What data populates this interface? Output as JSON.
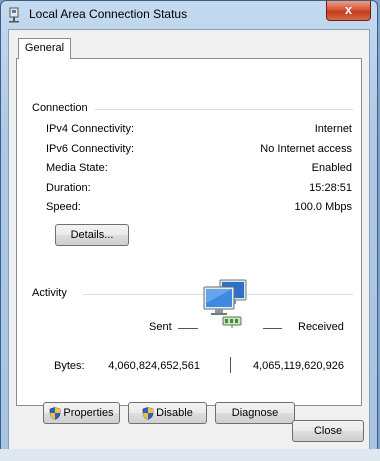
{
  "window": {
    "title": "Local Area Connection Status",
    "close_glyph": "x"
  },
  "tabs": [
    {
      "label": "General"
    }
  ],
  "connection": {
    "group_label": "Connection",
    "rows": [
      {
        "label": "IPv4 Connectivity:",
        "value": "Internet"
      },
      {
        "label": "IPv6 Connectivity:",
        "value": "No Internet access"
      },
      {
        "label": "Media State:",
        "value": "Enabled"
      },
      {
        "label": "Duration:",
        "value": "15:28:51"
      },
      {
        "label": "Speed:",
        "value": "100.0 Mbps"
      }
    ],
    "details_button": "Details..."
  },
  "activity": {
    "group_label": "Activity",
    "sent_label": "Sent",
    "received_label": "Received",
    "bytes_label": "Bytes:",
    "bytes_sent": "4,060,824,652,561",
    "bytes_received": "4,065,119,620,926"
  },
  "buttons": {
    "properties": "Properties",
    "disable": "Disable",
    "diagnose": "Diagnose",
    "close": "Close"
  },
  "icons": {
    "title_icon": "network-adapter-icon",
    "activity_icon": "network-computers-icon",
    "uac_icon": "uac-shield-icon"
  },
  "colors": {
    "title_gradient_top": "#c4daef",
    "close_button_red": "#c5391b",
    "panel_background": "#ffffff",
    "dialog_background": "#f0f0f0"
  }
}
